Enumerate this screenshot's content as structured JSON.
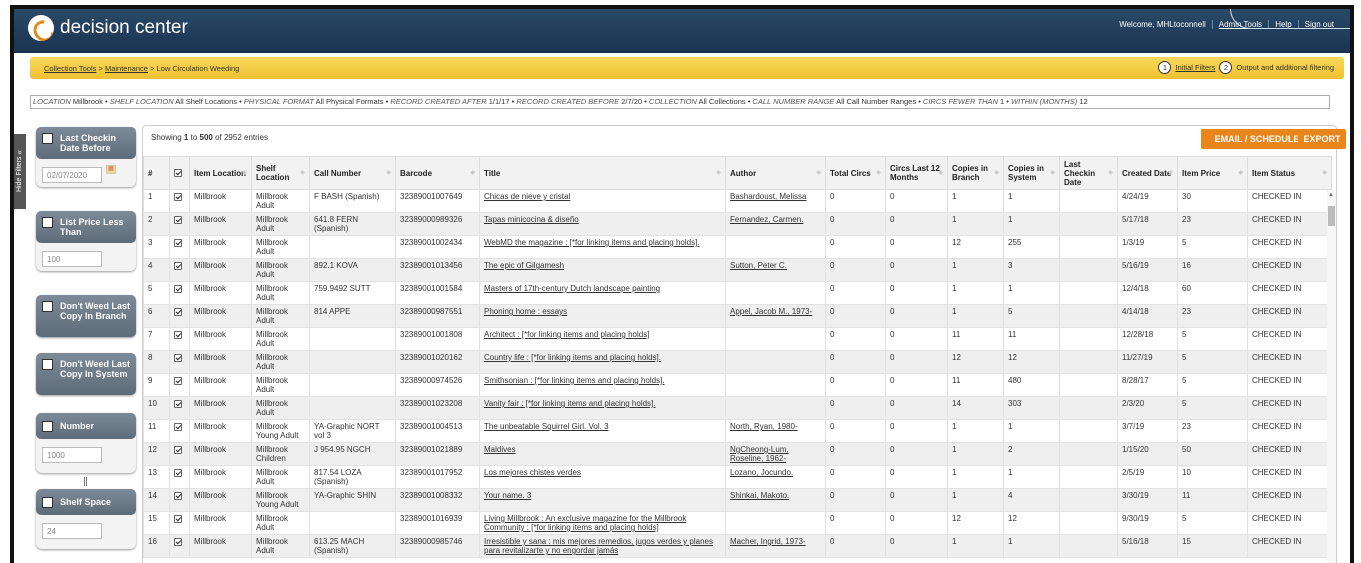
{
  "header": {
    "app_name": "decision center",
    "welcome": "Welcome, MHLtoconnell",
    "links": [
      "Admin Tools",
      "Help",
      "Sign out"
    ]
  },
  "breadcrumb": {
    "items": [
      "Collection Tools",
      "Maintenance"
    ],
    "current": "Low Circulation Weeding",
    "separator": ">"
  },
  "steps": [
    {
      "num": "1",
      "label": "Initial Filters"
    },
    {
      "num": "2",
      "label": "Output and additional filtering"
    }
  ],
  "filters_summary": [
    {
      "name": "LOCATION",
      "value": "Millbrook"
    },
    {
      "name": "SHELF LOCATION",
      "value": "All Shelf Locations"
    },
    {
      "name": "PHYSICAL FORMAT",
      "value": "All Physical Formats"
    },
    {
      "name": "RECORD CREATED AFTER",
      "value": "1/1/17"
    },
    {
      "name": "RECORD CREATED BEFORE",
      "value": "2/7/20"
    },
    {
      "name": "COLLECTION",
      "value": "All Collections"
    },
    {
      "name": "CALL NUMBER RANGE",
      "value": "All Call Number Ranges"
    },
    {
      "name": "CIRCS FEWER THAN",
      "value": "1"
    },
    {
      "name": "WITHIN (MONTHS)",
      "value": "12"
    }
  ],
  "sidebar": {
    "hide_label": "Hide Filters",
    "hide_arrow": "«",
    "filters": [
      {
        "label": "Last Checkin Date Before",
        "value": "02/07/2020",
        "cal_icon": "calendar-icon"
      },
      {
        "label": "List Price Less Than",
        "value": "100"
      },
      {
        "label": "Don't Weed Last Copy In Branch"
      },
      {
        "label": "Don't Weed Last Copy In System"
      },
      {
        "label": "Number",
        "value": "1000"
      },
      {
        "label": "Shelf Space",
        "value": "24"
      }
    ]
  },
  "table": {
    "info_prefix": "Showing ",
    "info_start": "1",
    "info_mid": " to ",
    "info_end": "500",
    "info_suffix": " of 2952 entries",
    "email_button": "EMAIL / SCHEDULE",
    "export_button": "EXPORT",
    "columns": [
      "#",
      "",
      "Item Location",
      "Shelf Location",
      "Call Number",
      "Barcode",
      "Title",
      "Author",
      "Total Circs",
      "Circs Last 12 Months",
      "Copies in Branch",
      "Copies in System",
      "Last Checkin Date",
      "Created Date",
      "Item Price",
      "Item Status"
    ],
    "rows": [
      [
        "1",
        "Millbrook",
        "Millbrook Adult",
        "F BASH (Spanish)",
        "32389001007649",
        "Chicas de nieve y cristal",
        "Bashardoust, Melissa",
        "0",
        "0",
        "1",
        "1",
        "",
        "4/24/19",
        "30",
        "CHECKED IN"
      ],
      [
        "2",
        "Millbrook",
        "Millbrook Adult",
        "641.8 FERN (Spanish)",
        "32389000989326",
        "Tapas minicocina & diseño",
        "Fernandez, Carmen.",
        "0",
        "0",
        "1",
        "1",
        "",
        "5/17/18",
        "23",
        "CHECKED IN"
      ],
      [
        "3",
        "Millbrook",
        "Millbrook Adult",
        "",
        "32389001002434",
        "WebMD the magazine : [*for linking items and placing holds].",
        "",
        "0",
        "0",
        "12",
        "255",
        "",
        "1/3/19",
        "5",
        "CHECKED IN"
      ],
      [
        "4",
        "Millbrook",
        "Millbrook Adult",
        "892.1 KOVA",
        "32389001013456",
        "The epic of Gilgamesh",
        "Sutton, Peter C.",
        "0",
        "0",
        "1",
        "3",
        "",
        "5/16/19",
        "16",
        "CHECKED IN"
      ],
      [
        "5",
        "Millbrook",
        "Millbrook Adult",
        "759.9492 SUTT",
        "32389001001584",
        "Masters of 17th-century Dutch landscape painting",
        "",
        "0",
        "0",
        "1",
        "1",
        "",
        "12/4/18",
        "60",
        "CHECKED IN"
      ],
      [
        "6",
        "Millbrook",
        "Millbrook Adult",
        "814 APPE",
        "32389000987551",
        "Phoning home : essays",
        "Appel, Jacob M., 1973-",
        "0",
        "0",
        "1",
        "5",
        "",
        "4/14/18",
        "23",
        "CHECKED IN"
      ],
      [
        "7",
        "Millbrook",
        "Millbrook Adult",
        "",
        "32389001001808",
        "Architect : [*for linking items and placing holds]",
        "",
        "0",
        "0",
        "11",
        "11",
        "",
        "12/28/18",
        "5",
        "CHECKED IN"
      ],
      [
        "8",
        "Millbrook",
        "Millbrook Adult",
        "",
        "32389001020162",
        "Country life : [*for linking items and placing holds].",
        "",
        "0",
        "0",
        "12",
        "12",
        "",
        "11/27/19",
        "5",
        "CHECKED IN"
      ],
      [
        "9",
        "Millbrook",
        "Millbrook Adult",
        "",
        "32389000974526",
        "Smithsonian : [*for linking items and placing holds].",
        "",
        "0",
        "0",
        "11",
        "480",
        "",
        "8/28/17",
        "5",
        "CHECKED IN"
      ],
      [
        "10",
        "Millbrook",
        "Millbrook Adult",
        "",
        "32389001023208",
        "Vanity fair : [*for linking items and placing holds].",
        "",
        "0",
        "0",
        "14",
        "303",
        "",
        "2/3/20",
        "5",
        "CHECKED IN"
      ],
      [
        "11",
        "Millbrook",
        "Millbrook Young Adult",
        "YA-Graphic NORT vol 3",
        "32389001004513",
        "The unbeatable Squirrel Girl. Vol. 3",
        "North, Ryan, 1980-",
        "0",
        "0",
        "1",
        "1",
        "",
        "3/7/19",
        "23",
        "CHECKED IN"
      ],
      [
        "12",
        "Millbrook",
        "Millbrook Children",
        "J 954.95 NGCH",
        "32389001021889",
        "Maldives",
        "NgCheong-Lum, Roseline, 1962-",
        "0",
        "0",
        "1",
        "2",
        "",
        "1/15/20",
        "50",
        "CHECKED IN"
      ],
      [
        "13",
        "Millbrook",
        "Millbrook Adult",
        "817.54 LOZA (Spanish)",
        "32389001017952",
        "Los mejores chistes verdes",
        "Lozano, Jocundo.",
        "0",
        "0",
        "1",
        "1",
        "",
        "2/5/19",
        "10",
        "CHECKED IN"
      ],
      [
        "14",
        "Millbrook",
        "Millbrook Young Adult",
        "YA-Graphic SHIN",
        "32389001008332",
        "Your name. 3",
        "Shinkai, Makoto.",
        "0",
        "0",
        "1",
        "4",
        "",
        "3/30/19",
        "11",
        "CHECKED IN"
      ],
      [
        "15",
        "Millbrook",
        "Millbrook Adult",
        "",
        "32389001016939",
        "Living Millbrook : An exclusive magazine for the Millbrook Community : [*for linking items and placing holds]",
        "",
        "0",
        "0",
        "12",
        "12",
        "",
        "9/30/19",
        "5",
        "CHECKED IN"
      ],
      [
        "16",
        "Millbrook",
        "Millbrook Adult",
        "613.25 MACH (Spanish)",
        "32389000985746",
        "Irresistible y sana : mis mejores remedios, jugos verdes y planes para revitalizarte y no engordar jamás",
        "Macher, Ingrid, 1973-",
        "0",
        "0",
        "1",
        "1",
        "",
        "5/16/18",
        "15",
        "CHECKED IN"
      ]
    ]
  }
}
